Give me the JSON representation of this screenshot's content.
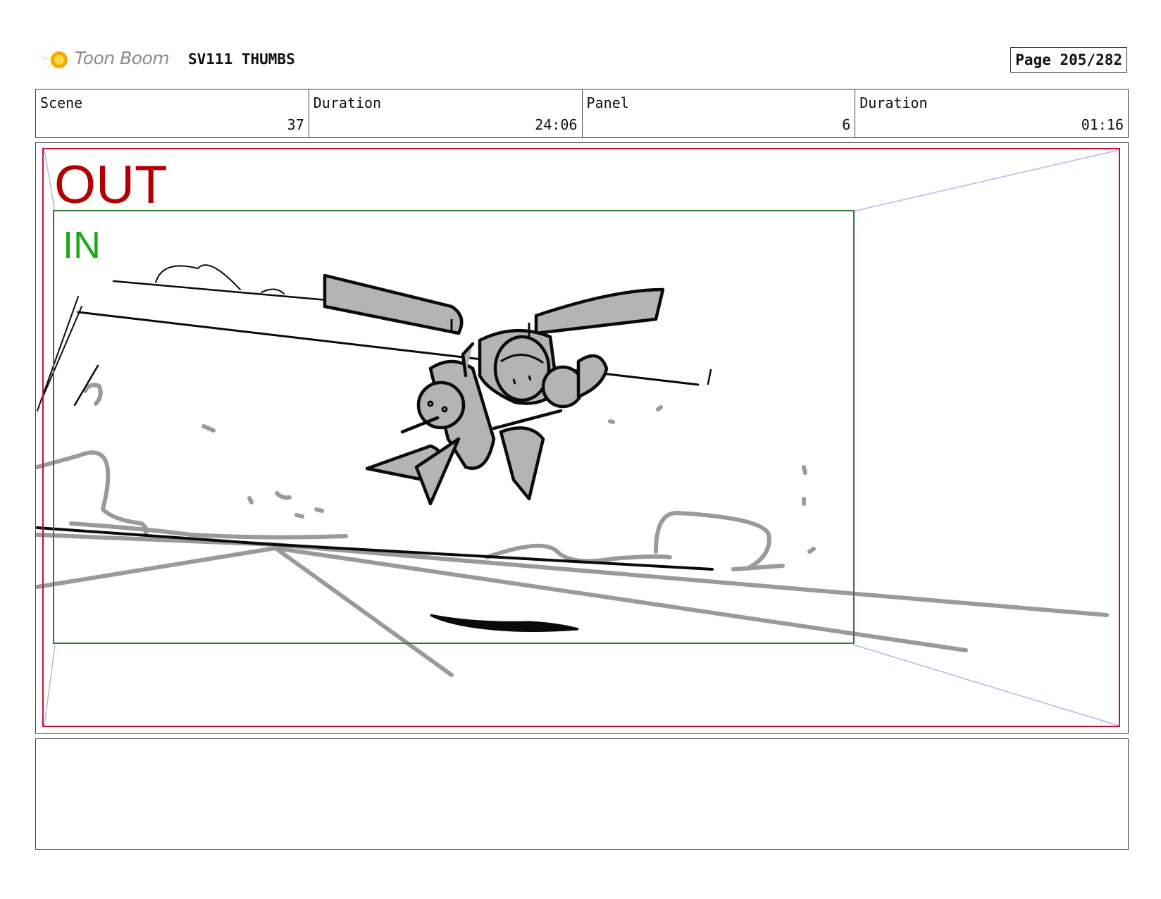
{
  "header": {
    "brand": "Toon Boom",
    "title": "SV111 THUMBS",
    "page": "Page 205/282"
  },
  "info": [
    {
      "label": "Scene",
      "value": "37"
    },
    {
      "label": "Duration",
      "value": "24:06"
    },
    {
      "label": "Panel",
      "value": "6"
    },
    {
      "label": "Duration",
      "value": "01:16"
    }
  ],
  "panel": {
    "out_label": "OUT",
    "in_label": "IN"
  },
  "colors": {
    "out_frame": "#c8102e",
    "in_frame": "#2e7d32",
    "camera_lines": "#b9b4e8",
    "sketch_gray": "#9a9a9a",
    "sketch_black": "#0a0a0a",
    "logo": "#f5c400"
  },
  "notes": {
    "text": ""
  }
}
